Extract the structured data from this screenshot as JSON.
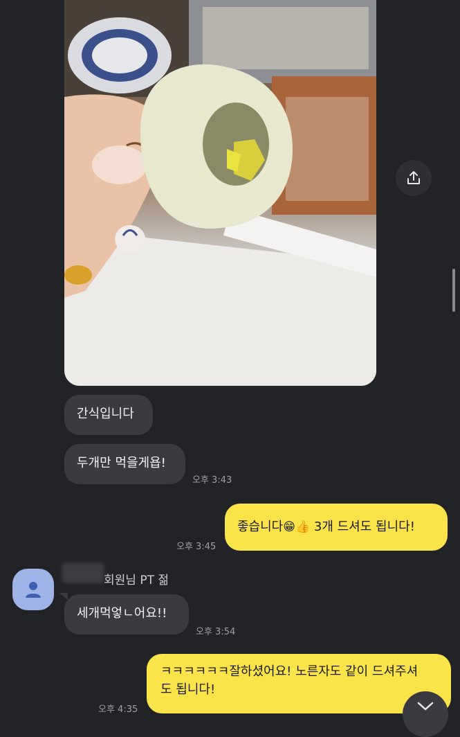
{
  "messages": {
    "m1": "간식입니다",
    "m2": "두개만 먹을게욥!",
    "t2": "오후 3:43",
    "m3_part1": "좋습니다",
    "m3_emoji1": "😁",
    "m3_emoji2": "👍",
    "m3_part2": " 3개 드셔도 됩니다!",
    "t3": "오후 3:45",
    "sender": "회원님 PT 젊",
    "m4": "세개먹엏ㄴ어요!!",
    "t4": "오후 3:54",
    "m5_line1": "ㅋㅋㅋㅋㅋㅋ잘하셨어요! 노른자도 같이 드셔주셔",
    "m5_line2": "도 됩니다!",
    "t5": "오후 4:35"
  },
  "colors": {
    "background": "#222327",
    "incoming_bubble": "#3a3b40",
    "outgoing_bubble": "#fbe34a",
    "avatar": "#9fb3e6"
  },
  "icons": {
    "share": "share-icon",
    "avatar": "person-icon",
    "scroll_down": "chevron-down-icon"
  }
}
